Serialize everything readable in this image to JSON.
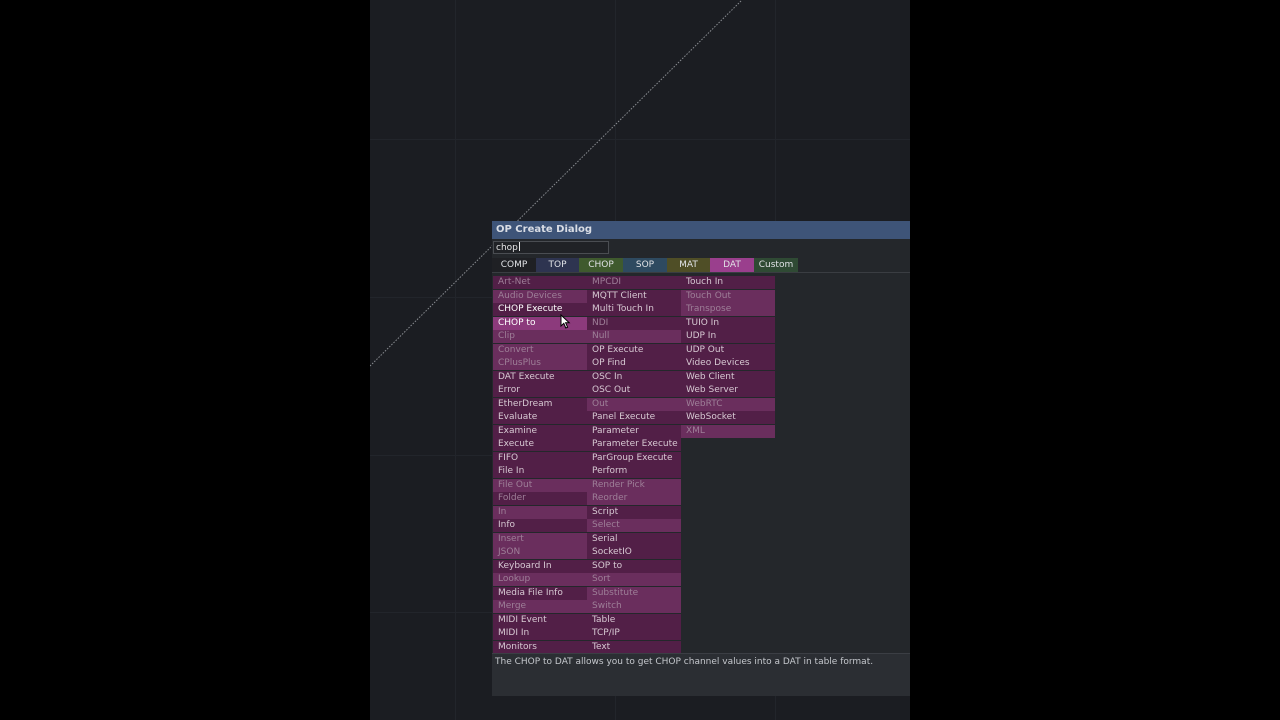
{
  "dialog": {
    "title": "OP Create Dialog",
    "search_value": "chop"
  },
  "tabs": [
    {
      "label": "COMP",
      "color": "#1f2024"
    },
    {
      "label": "TOP",
      "color": "#2e3450"
    },
    {
      "label": "CHOP",
      "color": "#3f5a2e"
    },
    {
      "label": "SOP",
      "color": "#2e4a60"
    },
    {
      "label": "MAT",
      "color": "#4f4e26"
    },
    {
      "label": "DAT",
      "color": "#9a3f8d"
    },
    {
      "label": "Custom",
      "color": "#2f4a34"
    }
  ],
  "colors": {
    "item_bright_bg": "#6a2e5d",
    "item_dark_bg": "#521f47",
    "item_highlight_bg": "#8c3a7c",
    "item_text": "#d7c9d3",
    "item_dim_text": "#9e7f98",
    "item_selected_text": "#ffffff"
  },
  "operators": {
    "column1": [
      {
        "label": "Art-Net",
        "shade": "dark",
        "dim": true
      },
      {
        "label": "Audio Devices",
        "shade": "bright",
        "dim": true
      },
      {
        "label": "CHOP Execute",
        "shade": "dark",
        "dim": false,
        "selected": true
      },
      {
        "label": "CHOP to",
        "shade": "highlight",
        "dim": false,
        "selected": true
      },
      {
        "label": "Clip",
        "shade": "bright",
        "dim": true
      },
      {
        "label": "Convert",
        "shade": "bright",
        "dim": true
      },
      {
        "label": "CPlusPlus",
        "shade": "bright",
        "dim": true
      },
      {
        "label": "DAT Execute",
        "shade": "dark",
        "dim": false
      },
      {
        "label": "Error",
        "shade": "dark",
        "dim": false
      },
      {
        "label": "EtherDream",
        "shade": "dark",
        "dim": false
      },
      {
        "label": "Evaluate",
        "shade": "dark",
        "dim": false
      },
      {
        "label": "Examine",
        "shade": "dark",
        "dim": false
      },
      {
        "label": "Execute",
        "shade": "dark",
        "dim": false
      },
      {
        "label": "FIFO",
        "shade": "dark",
        "dim": false
      },
      {
        "label": "File In",
        "shade": "dark",
        "dim": false
      },
      {
        "label": "File Out",
        "shade": "bright",
        "dim": true
      },
      {
        "label": "Folder",
        "shade": "dark",
        "dim": true
      },
      {
        "label": "In",
        "shade": "bright",
        "dim": true
      },
      {
        "label": "Info",
        "shade": "dark",
        "dim": false
      },
      {
        "label": "Insert",
        "shade": "bright",
        "dim": true
      },
      {
        "label": "JSON",
        "shade": "bright",
        "dim": true
      },
      {
        "label": "Keyboard In",
        "shade": "dark",
        "dim": false
      },
      {
        "label": "Lookup",
        "shade": "bright",
        "dim": true
      },
      {
        "label": "Media File Info",
        "shade": "dark",
        "dim": false
      },
      {
        "label": "Merge",
        "shade": "bright",
        "dim": true
      },
      {
        "label": "MIDI Event",
        "shade": "dark",
        "dim": false
      },
      {
        "label": "MIDI In",
        "shade": "dark",
        "dim": false
      },
      {
        "label": "Monitors",
        "shade": "dark",
        "dim": false
      }
    ],
    "column2": [
      {
        "label": "MPCDI",
        "shade": "dark",
        "dim": true
      },
      {
        "label": "MQTT Client",
        "shade": "dark",
        "dim": false
      },
      {
        "label": "Multi Touch In",
        "shade": "dark",
        "dim": false
      },
      {
        "label": "NDI",
        "shade": "dark",
        "dim": true
      },
      {
        "label": "Null",
        "shade": "bright",
        "dim": true
      },
      {
        "label": "OP Execute",
        "shade": "dark",
        "dim": false
      },
      {
        "label": "OP Find",
        "shade": "dark",
        "dim": false
      },
      {
        "label": "OSC In",
        "shade": "dark",
        "dim": false
      },
      {
        "label": "OSC Out",
        "shade": "dark",
        "dim": false
      },
      {
        "label": "Out",
        "shade": "bright",
        "dim": true
      },
      {
        "label": "Panel Execute",
        "shade": "dark",
        "dim": false
      },
      {
        "label": "Parameter",
        "shade": "dark",
        "dim": false
      },
      {
        "label": "Parameter Execute",
        "shade": "dark",
        "dim": false
      },
      {
        "label": "ParGroup Execute",
        "shade": "dark",
        "dim": false
      },
      {
        "label": "Perform",
        "shade": "dark",
        "dim": false
      },
      {
        "label": "Render Pick",
        "shade": "bright",
        "dim": true
      },
      {
        "label": "Reorder",
        "shade": "bright",
        "dim": true
      },
      {
        "label": "Script",
        "shade": "dark",
        "dim": false
      },
      {
        "label": "Select",
        "shade": "bright",
        "dim": true
      },
      {
        "label": "Serial",
        "shade": "dark",
        "dim": false
      },
      {
        "label": "SocketIO",
        "shade": "dark",
        "dim": false
      },
      {
        "label": "SOP to",
        "shade": "dark",
        "dim": false
      },
      {
        "label": "Sort",
        "shade": "bright",
        "dim": true
      },
      {
        "label": "Substitute",
        "shade": "bright",
        "dim": true
      },
      {
        "label": "Switch",
        "shade": "bright",
        "dim": true
      },
      {
        "label": "Table",
        "shade": "dark",
        "dim": false
      },
      {
        "label": "TCP/IP",
        "shade": "dark",
        "dim": false
      },
      {
        "label": "Text",
        "shade": "dark",
        "dim": false
      }
    ],
    "column3": [
      {
        "label": "Touch In",
        "shade": "dark",
        "dim": false
      },
      {
        "label": "Touch Out",
        "shade": "bright",
        "dim": true
      },
      {
        "label": "Transpose",
        "shade": "bright",
        "dim": true
      },
      {
        "label": "TUIO In",
        "shade": "dark",
        "dim": false
      },
      {
        "label": "UDP In",
        "shade": "dark",
        "dim": false
      },
      {
        "label": "UDP Out",
        "shade": "dark",
        "dim": false
      },
      {
        "label": "Video Devices",
        "shade": "dark",
        "dim": false
      },
      {
        "label": "Web Client",
        "shade": "dark",
        "dim": false
      },
      {
        "label": "Web Server",
        "shade": "dark",
        "dim": false
      },
      {
        "label": "WebRTC",
        "shade": "bright",
        "dim": true
      },
      {
        "label": "WebSocket",
        "shade": "dark",
        "dim": false
      },
      {
        "label": "XML",
        "shade": "bright",
        "dim": true
      }
    ]
  },
  "description": "The CHOP to DAT allows you to get CHOP channel values into a DAT in table format."
}
